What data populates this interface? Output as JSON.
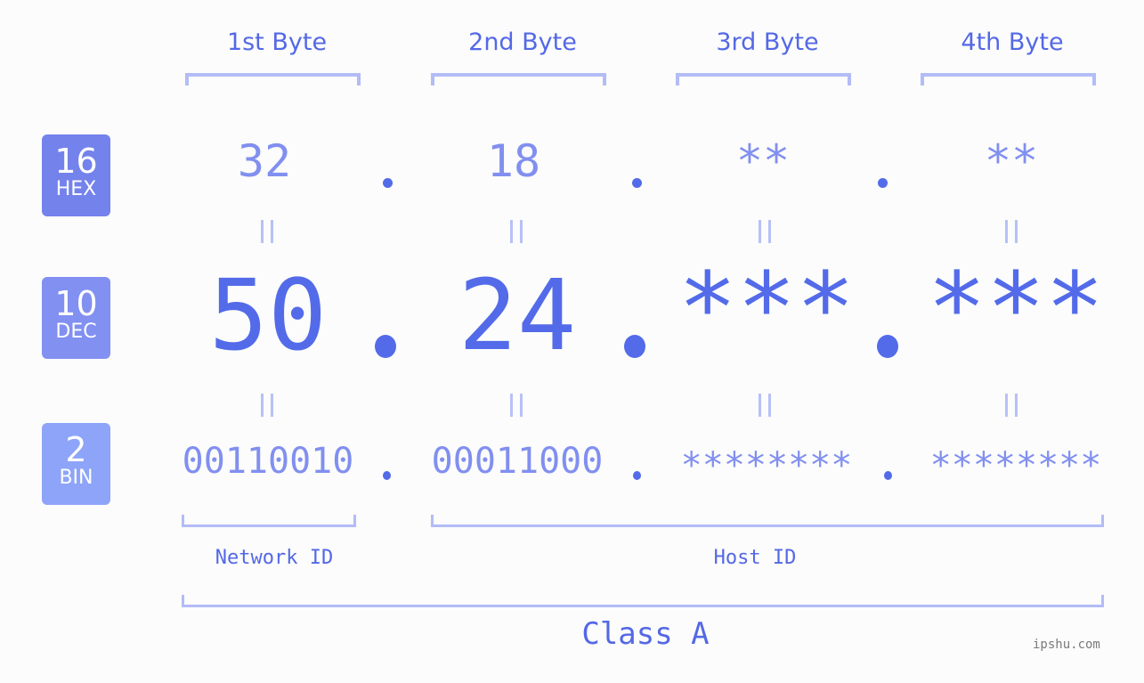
{
  "headers": [
    "1st Byte",
    "2nd Byte",
    "3rd Byte",
    "4th Byte"
  ],
  "badges": {
    "hex": {
      "base": "16",
      "label": "HEX",
      "color": "#7482ec"
    },
    "dec": {
      "base": "10",
      "label": "DEC",
      "color": "#8190f1"
    },
    "bin": {
      "base": "2",
      "label": "BIN",
      "color": "#8da4f9"
    }
  },
  "hex_values": [
    "32",
    "18",
    "**",
    "**"
  ],
  "dec_values": [
    "50",
    "24",
    "***",
    "***"
  ],
  "bin_values": [
    "00110010",
    "00011000",
    "********",
    "********"
  ],
  "separator": ".",
  "equals_symbol": "=",
  "parts": {
    "network_label": "Network ID",
    "host_label": "Host ID"
  },
  "ip_class": "Class A",
  "watermark": "ipshu.com",
  "colors": {
    "accent": "#536be9",
    "light": "#818ff0",
    "bracket": "#b3bcf6"
  }
}
